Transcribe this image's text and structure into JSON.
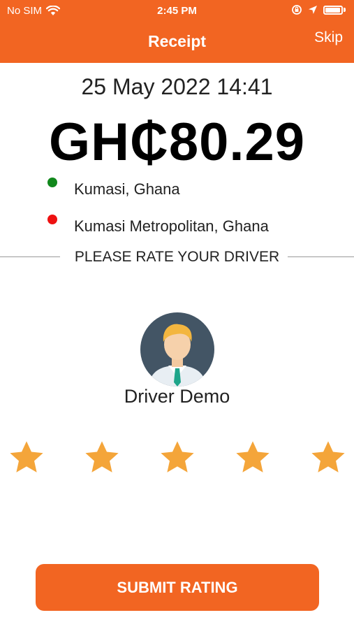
{
  "status_bar": {
    "carrier": "No SIM",
    "time": "2:45 PM",
    "icons": [
      "wifi-icon",
      "orientation-lock-icon",
      "location-arrow-icon",
      "battery-icon"
    ]
  },
  "header": {
    "title": "Receipt",
    "skip_label": "Skip"
  },
  "receipt": {
    "datetime": "25 May 2022 14:41",
    "amount": "GH₵80.29",
    "pickup": "Kumasi, Ghana",
    "dropoff": "Kumasi Metropolitan, Ghana"
  },
  "rating": {
    "prompt": "PLEASE RATE YOUR DRIVER",
    "driver_name": "Driver Demo",
    "max_stars": 5,
    "selected_stars": 5,
    "submit_label": "SUBMIT RATING"
  },
  "colors": {
    "accent": "#f26522",
    "star": "#f4a53a",
    "pickup_dot": "#11881c",
    "dropoff_dot": "#ee1111"
  }
}
